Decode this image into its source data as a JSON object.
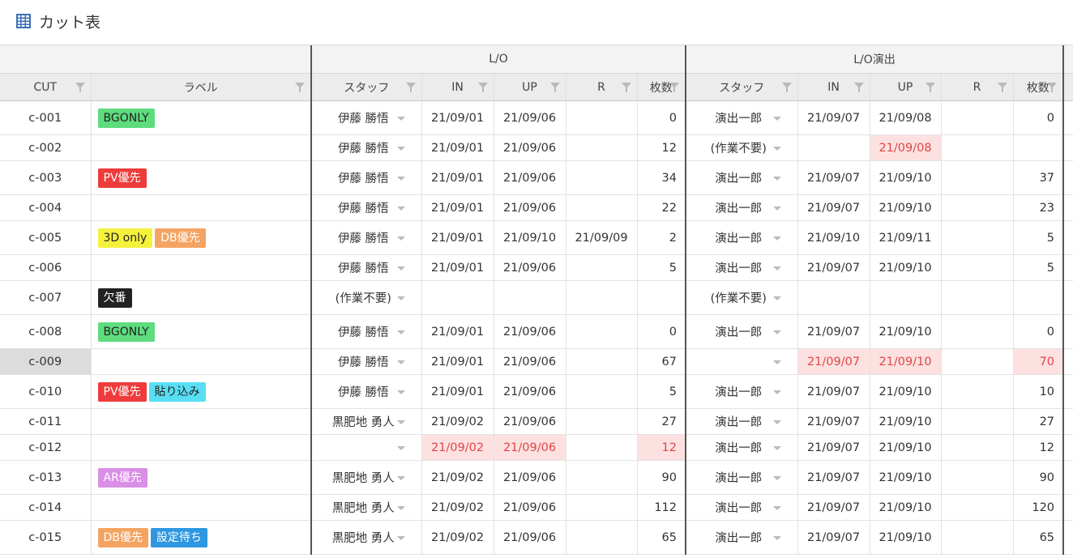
{
  "title": "カット表",
  "title_icon": "grid-table-icon",
  "groups": {
    "lo": "L/O",
    "lo_direction": "L/O演出"
  },
  "columns": {
    "cut": "CUT",
    "label": "ラベル",
    "lo_staff": "スタッフ",
    "lo_in": "IN",
    "lo_up": "UP",
    "lo_r": "R",
    "lo_count": "枚数",
    "dir_staff": "スタッフ",
    "dir_in": "IN",
    "dir_up": "UP",
    "dir_r": "R",
    "dir_count": "枚数"
  },
  "tag_colors": {
    "BGONLY": "#5edc7e",
    "PV優先": "#ef3b3b",
    "3D only": "#f5f23d",
    "DB優先": "#f4a462",
    "欠番": "#222222",
    "貼り込み": "#58dff4",
    "AR優先": "#d98fe6",
    "設定待ち": "#2e97e0"
  },
  "rows": [
    {
      "cut": "c-001",
      "labels": [
        "BGONLY"
      ],
      "lo_staff": "伊藤 勝悟",
      "lo_in": "21/09/01",
      "lo_up": "21/09/06",
      "lo_r": "",
      "lo_count": "0",
      "dir_staff": "演出一郎",
      "dir_in": "21/09/07",
      "dir_up": "21/09/08",
      "dir_r": "",
      "dir_count": "0",
      "h": 42
    },
    {
      "cut": "c-002",
      "labels": [],
      "lo_staff": "伊藤 勝悟",
      "lo_in": "21/09/01",
      "lo_up": "21/09/06",
      "lo_r": "",
      "lo_count": "12",
      "dir_staff": "(作業不要)",
      "dir_in": "",
      "dir_up": "21/09/08",
      "dir_r": "",
      "dir_count": "",
      "h": 32,
      "red": [
        "dir_up"
      ]
    },
    {
      "cut": "c-003",
      "labels": [
        "PV優先"
      ],
      "lo_staff": "伊藤 勝悟",
      "lo_in": "21/09/01",
      "lo_up": "21/09/06",
      "lo_r": "",
      "lo_count": "34",
      "dir_staff": "演出一郎",
      "dir_in": "21/09/07",
      "dir_up": "21/09/10",
      "dir_r": "",
      "dir_count": "37",
      "h": 42
    },
    {
      "cut": "c-004",
      "labels": [],
      "lo_staff": "伊藤 勝悟",
      "lo_in": "21/09/01",
      "lo_up": "21/09/06",
      "lo_r": "",
      "lo_count": "22",
      "dir_staff": "演出一郎",
      "dir_in": "21/09/07",
      "dir_up": "21/09/10",
      "dir_r": "",
      "dir_count": "23",
      "h": 32
    },
    {
      "cut": "c-005",
      "labels": [
        "3D only",
        "DB優先"
      ],
      "lo_staff": "伊藤 勝悟",
      "lo_in": "21/09/01",
      "lo_up": "21/09/10",
      "lo_r": "21/09/09",
      "lo_count": "2",
      "dir_staff": "演出一郎",
      "dir_in": "21/09/10",
      "dir_up": "21/09/11",
      "dir_r": "",
      "dir_count": "5",
      "h": 42
    },
    {
      "cut": "c-006",
      "labels": [],
      "lo_staff": "伊藤 勝悟",
      "lo_in": "21/09/01",
      "lo_up": "21/09/06",
      "lo_r": "",
      "lo_count": "5",
      "dir_staff": "演出一郎",
      "dir_in": "21/09/07",
      "dir_up": "21/09/10",
      "dir_r": "",
      "dir_count": "5",
      "h": 32
    },
    {
      "cut": "c-007",
      "labels": [
        "欠番"
      ],
      "lo_staff": "(作業不要)",
      "lo_in": "",
      "lo_up": "",
      "lo_r": "",
      "lo_count": "",
      "dir_staff": "(作業不要)",
      "dir_in": "",
      "dir_up": "",
      "dir_r": "",
      "dir_count": "",
      "h": 42
    },
    {
      "cut": "c-008",
      "labels": [
        "BGONLY"
      ],
      "lo_staff": "伊藤 勝悟",
      "lo_in": "21/09/01",
      "lo_up": "21/09/06",
      "lo_r": "",
      "lo_count": "0",
      "dir_staff": "演出一郎",
      "dir_in": "21/09/07",
      "dir_up": "21/09/10",
      "dir_r": "",
      "dir_count": "0",
      "h": 42
    },
    {
      "cut": "c-009",
      "labels": [],
      "selected": true,
      "lo_staff": "伊藤 勝悟",
      "lo_in": "21/09/01",
      "lo_up": "21/09/06",
      "lo_r": "",
      "lo_count": "67",
      "dir_staff": "",
      "dir_in": "21/09/07",
      "dir_up": "21/09/10",
      "dir_r": "",
      "dir_count": "70",
      "h": 32,
      "red": [
        "dir_in",
        "dir_up",
        "dir_count"
      ]
    },
    {
      "cut": "c-010",
      "labels": [
        "PV優先",
        "貼り込み"
      ],
      "lo_staff": "伊藤 勝悟",
      "lo_in": "21/09/01",
      "lo_up": "21/09/06",
      "lo_r": "",
      "lo_count": "5",
      "dir_staff": "演出一郎",
      "dir_in": "21/09/07",
      "dir_up": "21/09/10",
      "dir_r": "",
      "dir_count": "10",
      "h": 42
    },
    {
      "cut": "c-011",
      "labels": [],
      "lo_staff": "黒肥地 勇人",
      "lo_in": "21/09/02",
      "lo_up": "21/09/06",
      "lo_r": "",
      "lo_count": "27",
      "dir_staff": "演出一郎",
      "dir_in": "21/09/07",
      "dir_up": "21/09/10",
      "dir_r": "",
      "dir_count": "27",
      "h": 32
    },
    {
      "cut": "c-012",
      "labels": [],
      "lo_staff": "",
      "lo_in": "21/09/02",
      "lo_up": "21/09/06",
      "lo_r": "",
      "lo_count": "12",
      "dir_staff": "演出一郎",
      "dir_in": "21/09/07",
      "dir_up": "21/09/10",
      "dir_r": "",
      "dir_count": "12",
      "h": 32,
      "red": [
        "lo_in",
        "lo_up",
        "lo_count"
      ]
    },
    {
      "cut": "c-013",
      "labels": [
        "AR優先"
      ],
      "lo_staff": "黒肥地 勇人",
      "lo_in": "21/09/02",
      "lo_up": "21/09/06",
      "lo_r": "",
      "lo_count": "90",
      "dir_staff": "演出一郎",
      "dir_in": "21/09/07",
      "dir_up": "21/09/10",
      "dir_r": "",
      "dir_count": "90",
      "h": 42
    },
    {
      "cut": "c-014",
      "labels": [],
      "lo_staff": "黒肥地 勇人",
      "lo_in": "21/09/02",
      "lo_up": "21/09/06",
      "lo_r": "",
      "lo_count": "112",
      "dir_staff": "演出一郎",
      "dir_in": "21/09/07",
      "dir_up": "21/09/10",
      "dir_r": "",
      "dir_count": "120",
      "h": 32
    },
    {
      "cut": "c-015",
      "labels": [
        "DB優先",
        "設定待ち"
      ],
      "lo_staff": "黒肥地 勇人",
      "lo_in": "21/09/02",
      "lo_up": "21/09/06",
      "lo_r": "",
      "lo_count": "65",
      "dir_staff": "演出一郎",
      "dir_in": "21/09/07",
      "dir_up": "21/09/10",
      "dir_r": "",
      "dir_count": "65",
      "h": 42
    }
  ]
}
